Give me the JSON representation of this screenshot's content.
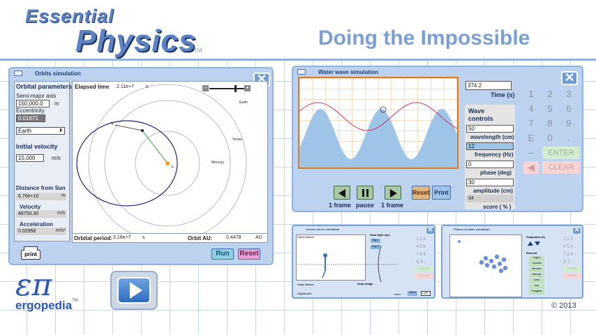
{
  "header": {
    "brand_line1": "Essential",
    "brand_line2": "Physics",
    "trademark": "TM",
    "page_title": "Doing the Impossible"
  },
  "orbits": {
    "title": "Orbits simulation",
    "params_heading": "Orbital parameters",
    "semi_major_label": "Semi-major axis",
    "semi_major_value": "150,000,0",
    "semi_major_unit": "m",
    "eccentricity_label": "Eccentricity",
    "eccentricity_value": "0.01671",
    "body_select": "Earth",
    "initial_velocity_heading": "Initial velocity",
    "velocity_input": "15,000",
    "velocity_unit": "m/s",
    "distance_label": "Distance from Sun",
    "distance_value": "6.70e+10",
    "distance_unit": "m",
    "velocity_label": "Velocity",
    "velocity_value": "48750.30",
    "velocity_out_unit": "m/s",
    "accel_label": "Acceleration",
    "accel_value": "0.02958",
    "accel_unit": "m/s²",
    "elapsed_label": "Elapsed time",
    "elapsed_value": "2.11e+7",
    "elapsed_unit": "s",
    "period_label": "Orbital period:",
    "period_value": "3.16e+7",
    "period_unit": "s",
    "au_label": "Orbit AU:",
    "au_value": "0.4478",
    "au_unit": "AU",
    "planet_labels": {
      "earth": "Earth",
      "venus": "Venus",
      "mercury": "Mercury",
      "v": "V",
      "f": "F"
    },
    "print_label": "print",
    "run_label": "Run",
    "reset_label": "Reset"
  },
  "wave": {
    "title": "Water wave simulation",
    "time_value": "374.2",
    "time_label": "Time (s)",
    "controls_heading": "Wave controls",
    "wavelength_value": "50",
    "wavelength_label": "wavelength (cm)",
    "frequency_value": "12",
    "frequency_label": "frequency (Hz)",
    "phase_value": "0",
    "phase_label": "phase (deg)",
    "amplitude_value": "30",
    "amplitude_label": "amplitude (cm)",
    "score_value": "34",
    "score_label": "score ( % )",
    "frame_back_label": "1 frame",
    "pause_label": "pause",
    "frame_fwd_label": "1 frame",
    "reset_label": "Reset",
    "print_label": "Print",
    "keypad": [
      "1",
      "2",
      "3",
      "4",
      "5",
      "6",
      "7",
      "8",
      "9",
      "E",
      "0",
      "."
    ],
    "minus_label": "–",
    "enter_label": "ENTER",
    "clear_label": "CLEAR"
  },
  "mirror": {
    "title": "Convex mirror simulation",
    "image_heading": "Draw image",
    "rays_heading": "Draw light rays",
    "ray1": "Ray 1",
    "ray2": "Ray 2",
    "print_label": "print",
    "reset_label": "Reset",
    "object_distance": "Object distance",
    "image_label": "Image distance",
    "magnification": "Magnification",
    "score_label": "score:",
    "enter_label": "ENTER",
    "clear_label": "CLEAR"
  },
  "phases": {
    "title": "Phases of water simulation",
    "temperature_label": "Temperature (K)",
    "element_label": "Element",
    "elements": [
      "Argon",
      "Chlorine",
      "Bromine",
      "Mercury",
      "Lead",
      "Iron",
      "Tungsten"
    ],
    "enter_label": "ENTER",
    "clear_label": "CLEAR"
  },
  "footer": {
    "logo_symbol": "επ",
    "logo_text": "ergopedia",
    "logo_tm": "TM",
    "copyright": "© 2013"
  }
}
